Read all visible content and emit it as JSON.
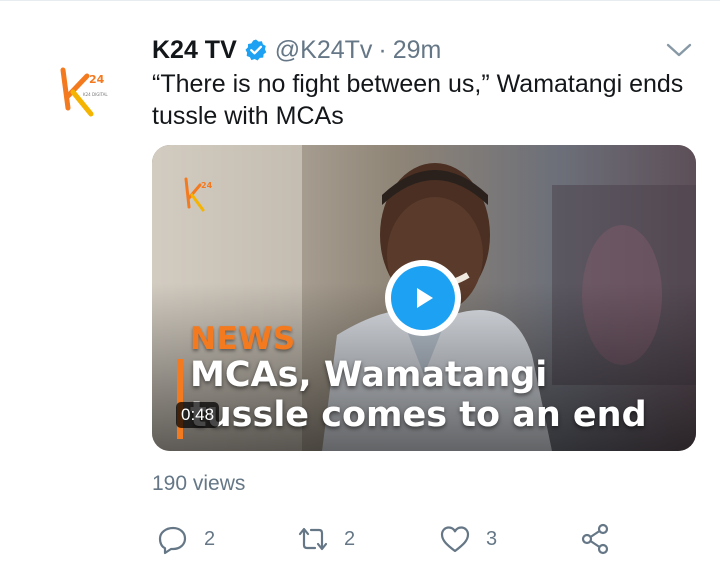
{
  "tweet": {
    "display_name": "K24 TV",
    "handle": "@K24Tv",
    "separator": "·",
    "timestamp": "29m",
    "text": "“There is no fight between us,” Wamatangi ends tussle with MCAs",
    "avatar_icon": "k24-logo",
    "verified_icon": "verified-badge-icon",
    "menu_icon": "chevron-down-icon"
  },
  "media": {
    "overlay_news": "NEWS",
    "overlay_line1": "MCAs, Wamatangi",
    "overlay_line2": "tussle comes to an end",
    "duration": "0:48",
    "play_icon": "play-icon"
  },
  "stats": {
    "views": "190 views"
  },
  "actions": {
    "reply": {
      "icon": "reply-icon",
      "count": "2"
    },
    "retweet": {
      "icon": "retweet-icon",
      "count": "2"
    },
    "like": {
      "icon": "heart-icon",
      "count": "3"
    },
    "share": {
      "icon": "share-icon"
    }
  },
  "colors": {
    "text_primary": "#14171a",
    "text_secondary": "#657786",
    "accent_blue": "#1da1f2",
    "brand_orange": "#f47a20"
  }
}
